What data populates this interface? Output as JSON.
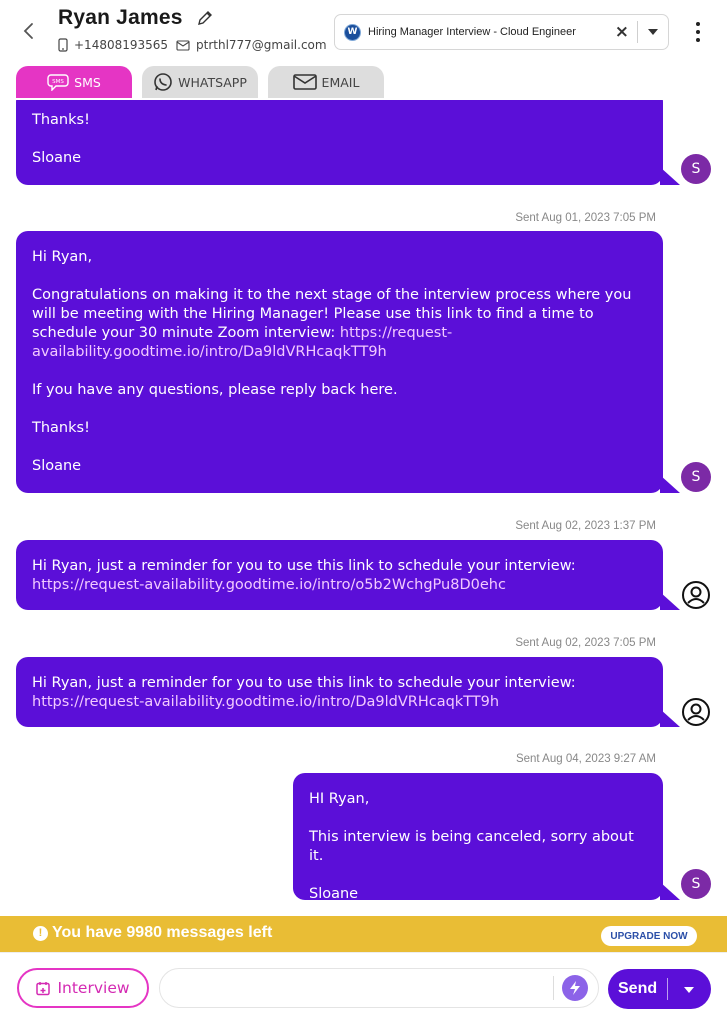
{
  "contact": {
    "name": "Ryan James",
    "phone": "+14808193565",
    "email": "ptrthl777@gmail.com"
  },
  "job_select": {
    "logo_letter": "W",
    "value": "Hiring Manager Interview - Cloud Engineer"
  },
  "tabs": [
    {
      "label": "SMS",
      "icon": "sms-icon",
      "active": true
    },
    {
      "label": "WHATSAPP",
      "icon": "whatsapp-icon",
      "active": false
    },
    {
      "label": "EMAIL",
      "icon": "mail-icon",
      "active": false
    }
  ],
  "messages": {
    "m1": {
      "lines": [
        "Thanks!",
        "Sloane"
      ],
      "avatar": "S"
    },
    "m2": {
      "stamp": "Sent Aug 01, 2023 7:05 PM",
      "greeting": "Hi Ryan,",
      "body": "Congratulations on making it to the next stage of the interview process where you will be meeting with the Hiring Manager! Please use this link to find a time to schedule your 30 minute Zoom interview:",
      "link": "https://request-availability.goodtime.io/intro/Da9ldVRHcaqkTT9h",
      "questions": "If you have any questions, please reply back here.",
      "thanks": "Thanks!",
      "signature": "Sloane",
      "avatar": "S"
    },
    "m3": {
      "stamp": "Sent Aug 02, 2023 1:37 PM",
      "text": "Hi Ryan, just a reminder for you to use this link to schedule your interview:",
      "link": "https://request-availability.goodtime.io/intro/o5b2WchgPu8D0ehc",
      "avatar_icon": "bot-user-icon"
    },
    "m4": {
      "stamp": "Sent Aug 02, 2023 7:05 PM",
      "text": "Hi Ryan, just a reminder for you to use this link to schedule your interview:",
      "link": "https://request-availability.goodtime.io/intro/Da9ldVRHcaqkTT9h",
      "avatar_icon": "bot-user-icon"
    },
    "m5": {
      "stamp": "Sent Aug 04, 2023 9:27 AM",
      "greeting": "HI Ryan,",
      "body": "This interview is being canceled, sorry about it.",
      "signature": "Sloane",
      "avatar": "S"
    }
  },
  "banner": {
    "text": "You have 9980 messages left",
    "upgrade_label": "UPGRADE NOW"
  },
  "compose": {
    "interview_label": "Interview",
    "placeholder": "",
    "send_label": "Send"
  },
  "colors": {
    "bubble": "#5b0fd8",
    "accent_pink": "#e535c4",
    "banner": "#e9bd35",
    "avatar": "#7c2aa6"
  }
}
